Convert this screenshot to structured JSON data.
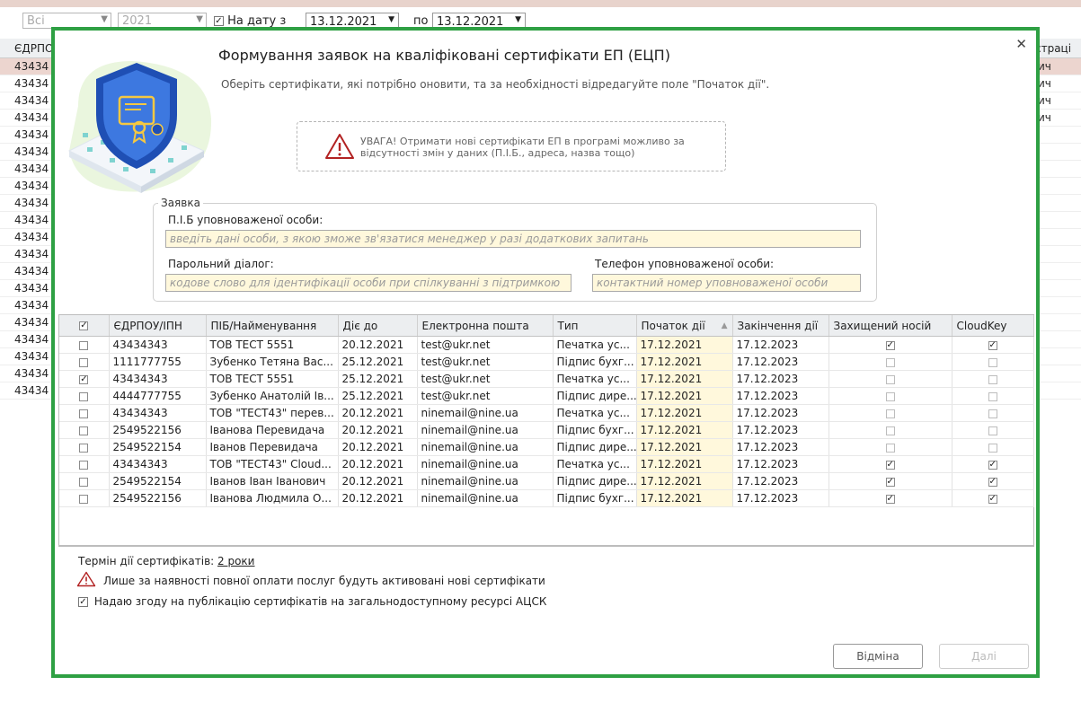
{
  "background": {
    "filter_all": "Всі",
    "filter_year": "2021",
    "on_date_label": "На дату з",
    "date_from": "13.12.2021",
    "to_label": "по",
    "date_to": "13.12.2021",
    "col_edrpou": "ЄДРПО",
    "col_reg": "страці",
    "row_value": "43434",
    "row_tail": "ич"
  },
  "dialog": {
    "title": "Формування заявок на кваліфіковані сертифікати ЕП (ЕЦП)",
    "subtitle": "Оберіть сертифікати, які потрібно оновити, та за необхідності відредагуйте поле \"Початок дії\".",
    "warning": "УВАГА! Отримати нові сертифікати ЕП в програмі можливо за відсутності змін у даних (П.І.Б., адреса, назва тощо)",
    "fieldset_legend": "Заявка",
    "person_label": "П.І.Б уповноваженої особи:",
    "person_placeholder": "введіть дані особи, з якою зможе зв'язатися менеджер у разі додаткових запитань",
    "password_label": "Парольний діалог:",
    "password_placeholder": "кодове слово для ідентифікації особи при спілкуванні з підтримкою",
    "phone_label": "Телефон уповноваженої особи:",
    "phone_placeholder": "контактний номер уповноваженої особи",
    "columns": [
      "ЄДРПОУ/ІПН",
      "ПІБ/Найменування",
      "Діє до",
      "Електронна пошта",
      "Тип",
      "Початок дії",
      "Закінчення дії",
      "Захищений носій",
      "CloudKey"
    ],
    "rows": [
      {
        "code": "43434343",
        "name": "ТОВ ТЕСТ 5551",
        "valid": "20.12.2021",
        "email": "test@ukr.net",
        "type": "Печатка ус...",
        "start": "17.12.2021",
        "end": "17.12.2023"
      },
      {
        "code": "1111777755",
        "name": "Зубенко Тетяна Вас...",
        "valid": "25.12.2021",
        "email": "test@ukr.net",
        "type": "Підпис бухг...",
        "start": "17.12.2021",
        "end": "17.12.2023"
      },
      {
        "code": "43434343",
        "name": "ТОВ ТЕСТ 5551",
        "valid": "25.12.2021",
        "email": "test@ukr.net",
        "type": "Печатка ус...",
        "start": "17.12.2021",
        "end": "17.12.2023"
      },
      {
        "code": "4444777755",
        "name": "Зубенко Анатолій Ів...",
        "valid": "25.12.2021",
        "email": "test@ukr.net",
        "type": "Підпис дире...",
        "start": "17.12.2021",
        "end": "17.12.2023"
      },
      {
        "code": "43434343",
        "name": "ТОВ \"ТЕСТ43\" перев...",
        "valid": "20.12.2021",
        "email": "ninemail@nine.ua",
        "type": "Печатка ус...",
        "start": "17.12.2021",
        "end": "17.12.2023"
      },
      {
        "code": "2549522156",
        "name": "Іванова Перевидача",
        "valid": "20.12.2021",
        "email": "ninemail@nine.ua",
        "type": "Підпис бухг...",
        "start": "17.12.2021",
        "end": "17.12.2023"
      },
      {
        "code": "2549522154",
        "name": "Іванов Перевидача",
        "valid": "20.12.2021",
        "email": "ninemail@nine.ua",
        "type": "Підпис дире...",
        "start": "17.12.2021",
        "end": "17.12.2023"
      },
      {
        "code": "43434343",
        "name": "ТОВ \"ТЕСТ43\" Cloud...",
        "valid": "20.12.2021",
        "email": "ninemail@nine.ua",
        "type": "Печатка ус...",
        "start": "17.12.2021",
        "end": "17.12.2023"
      },
      {
        "code": "2549522154",
        "name": "Іванов Іван Іванович",
        "valid": "20.12.2021",
        "email": "ninemail@nine.ua",
        "type": "Підпис дире...",
        "start": "17.12.2021",
        "end": "17.12.2023"
      },
      {
        "code": "2549522156",
        "name": "Іванова Людмила О...",
        "valid": "20.12.2021",
        "email": "ninemail@nine.ua",
        "type": "Підпис бухг...",
        "start": "17.12.2021",
        "end": "17.12.2023"
      }
    ],
    "term_label": "Термін дії сертифікатів:",
    "term_value": "2 роки",
    "payment_note": "Лише за наявності повної оплати послуг будуть активовані нові сертифікати",
    "consent_label": "Надаю згоду на публікацію сертифікатів на загальнодоступному ресурсі АЦСК",
    "cancel_label": "Відміна",
    "next_label": "Далі"
  }
}
